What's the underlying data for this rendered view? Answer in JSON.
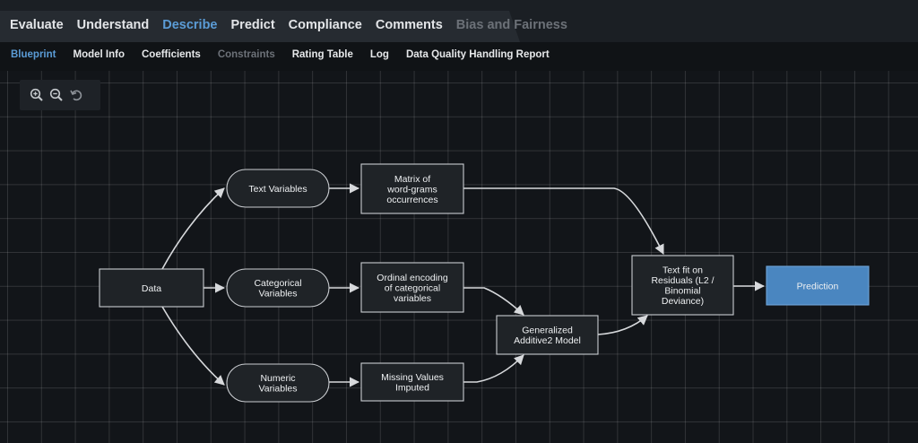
{
  "top_tabs": [
    {
      "label": "Evaluate"
    },
    {
      "label": "Understand"
    },
    {
      "label": "Describe"
    },
    {
      "label": "Predict"
    },
    {
      "label": "Compliance"
    },
    {
      "label": "Comments"
    },
    {
      "label": "Bias and Fairness"
    }
  ],
  "sub_tabs": [
    {
      "label": "Blueprint"
    },
    {
      "label": "Model Info"
    },
    {
      "label": "Coefficients"
    },
    {
      "label": "Constraints"
    },
    {
      "label": "Rating Table"
    },
    {
      "label": "Log"
    },
    {
      "label": "Data Quality Handling Report"
    }
  ],
  "zoom_controls": {
    "zoom_in_icon": "zoom-in-icon",
    "zoom_out_icon": "zoom-out-icon",
    "reset_icon": "reset-icon"
  },
  "blueprint": {
    "nodes": {
      "data": {
        "lines": [
          "Data"
        ]
      },
      "text_vars": {
        "lines": [
          "Text Variables"
        ]
      },
      "cat_vars": {
        "lines": [
          "Categorical",
          "Variables"
        ]
      },
      "num_vars": {
        "lines": [
          "Numeric",
          "Variables"
        ]
      },
      "word_grams": {
        "lines": [
          "Matrix of",
          "word-grams",
          "occurrences"
        ]
      },
      "ordinal": {
        "lines": [
          "Ordinal encoding",
          "of categorical",
          "variables"
        ]
      },
      "missing": {
        "lines": [
          "Missing Values",
          "Imputed"
        ]
      },
      "ga2m": {
        "lines": [
          "Generalized",
          "Additive2 Model"
        ]
      },
      "text_fit": {
        "lines": [
          "Text fit on",
          "Residuals (L2 /",
          "Binomial",
          "Deviance)"
        ]
      },
      "prediction": {
        "lines": [
          "Prediction"
        ]
      }
    },
    "colors": {
      "node_fill": "#1f2327",
      "node_stroke": "#c9ccd0",
      "edge": "#d7d9dc",
      "prediction_fill": "#4a86c0"
    }
  }
}
